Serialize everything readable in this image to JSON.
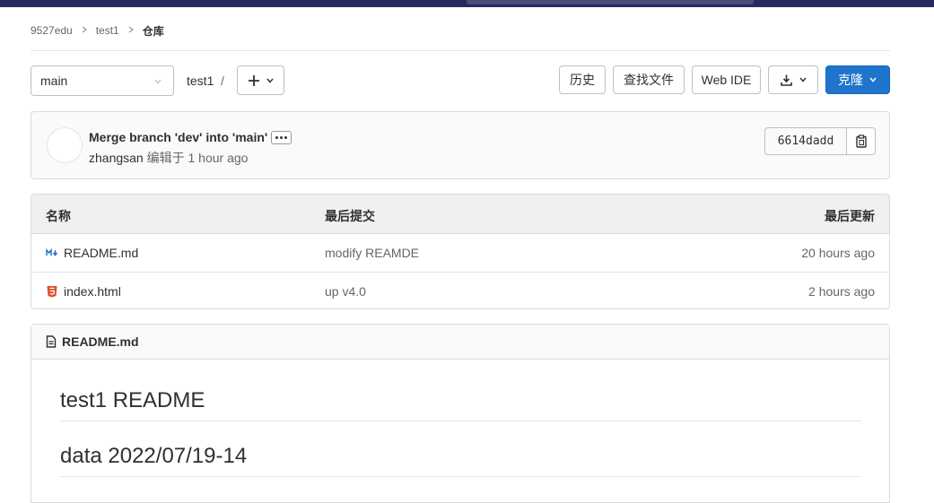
{
  "breadcrumb": [
    "9527edu",
    "test1",
    "仓库"
  ],
  "branch": {
    "name": "main"
  },
  "path": {
    "project": "test1",
    "slash": "/"
  },
  "toolbar": {
    "history": "历史",
    "find_file": "查找文件",
    "web_ide": "Web IDE",
    "clone": "克隆"
  },
  "commit": {
    "title": "Merge branch 'dev' into 'main'",
    "author": "zhangsan",
    "action": "编辑于",
    "time": "1 hour ago",
    "sha": "6614dadd"
  },
  "table": {
    "headers": {
      "name": "名称",
      "last_commit": "最后提交",
      "last_update": "最后更新"
    },
    "rows": [
      {
        "icon": "markdown-icon",
        "name": "README.md",
        "commit": "modify REAMDE",
        "updated": "20 hours ago"
      },
      {
        "icon": "html5-icon",
        "name": "index.html",
        "commit": "up v4.0",
        "updated": "2 hours ago"
      }
    ]
  },
  "readme": {
    "filename": "README.md",
    "headings": [
      "test1 README",
      "data 2022/07/19-14"
    ]
  },
  "colors": {
    "primary": "#1f75cb",
    "topbar": "#292961",
    "html_icon": "#e34c26",
    "md_icon": "#1f75cb"
  }
}
